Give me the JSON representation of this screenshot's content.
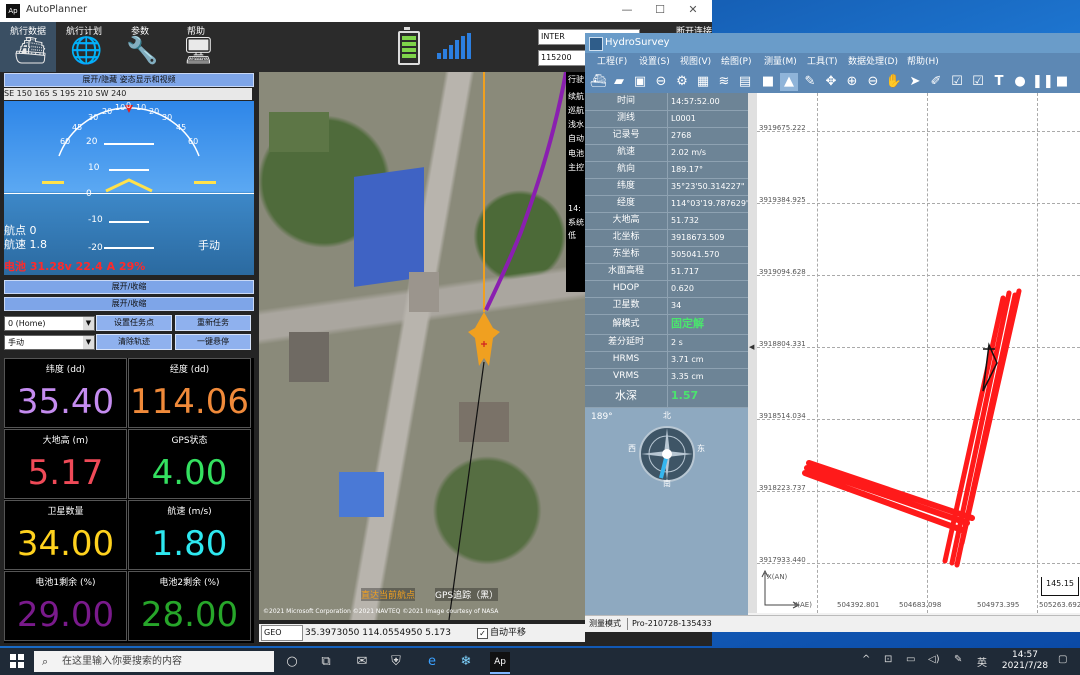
{
  "autoplanner": {
    "title": "AutoPlanner",
    "window_controls": [
      "—",
      "☐",
      "✕"
    ],
    "menu": [
      {
        "label": "航行数据",
        "icon": "boat-icon"
      },
      {
        "label": "航行计划",
        "icon": "globe-icon"
      },
      {
        "label": "参数",
        "icon": "tools-icon"
      },
      {
        "label": "帮助",
        "icon": "help-monitor-icon"
      }
    ],
    "connection": {
      "port": "INTER",
      "baud": "115200",
      "disconnect_label": "断开连接"
    },
    "panels": {
      "top_toggle": "展开/隐藏 姿态显示和视频",
      "compass_strip": "SE   150   165   S   195   210   SW   240",
      "toggle2": "展开/收缩",
      "toggle3": "展开/收缩"
    },
    "hud": {
      "arc_numbers": [
        "60",
        "45",
        "30",
        "20",
        "10",
        "0",
        "10",
        "20",
        "30",
        "45",
        "60"
      ],
      "pitch_labels": [
        "20",
        "10",
        "0",
        "-10",
        "-20"
      ],
      "waypoint": "航点 0",
      "speed": "航速 1.8",
      "mode": "手动",
      "battery": "电池 31.28v 22.4 A 29%"
    },
    "controls": {
      "waypoint_select": "0 (Home)",
      "mode_select": "手动",
      "buttons": [
        "设置任务点",
        "重新任务",
        "清除轨迹",
        "一键悬停"
      ]
    },
    "telemetry": [
      {
        "label": "纬度 (dd)",
        "value": "35.40",
        "color": "#c58cf0"
      },
      {
        "label": "经度 (dd)",
        "value": "114.06",
        "color": "#f08a3a"
      },
      {
        "label": "大地高 (m)",
        "value": "5.17",
        "color": "#f04a58"
      },
      {
        "label": "GPS状态",
        "value": "4.00",
        "color": "#34e060"
      },
      {
        "label": "卫星数量",
        "value": "34.00",
        "color": "#ffd21e"
      },
      {
        "label": "航速 (m/s)",
        "value": "1.80",
        "color": "#2ee8f0"
      },
      {
        "label": "电池1剩余 (%)",
        "value": "29.00",
        "color": "#7a1a8c"
      },
      {
        "label": "电池2剩余 (%)",
        "value": "28.00",
        "color": "#27a62a"
      }
    ],
    "right_strip": [
      "行驶",
      "续航",
      "巡航",
      "浅水",
      "自动",
      "电池",
      "主控",
      "14:",
      "系统",
      "低"
    ],
    "map": {
      "return_label": "直达当前航点",
      "gps_label": "GPS追踪（黑）",
      "copyright": "©2021 Microsoft Corporation ©2021 NAVTEQ ©2021 Image courtesy of NASA",
      "status": {
        "coord_system": "GEO",
        "readout": "35.3973050 114.0554950 5.173",
        "auto_pan": "自动平移"
      }
    }
  },
  "hydrosurvey": {
    "title": "HydroSurvey",
    "menu": [
      "工程(F)",
      "设置(S)",
      "视图(V)",
      "绘图(P)",
      "测量(M)",
      "工具(T)",
      "数据处理(D)",
      "帮助(H)"
    ],
    "toolbar_icons": [
      "ship-icon",
      "folder-icon",
      "save-icon",
      "link-icon",
      "gear-icon",
      "image-icon",
      "wave-icon",
      "note-icon",
      "video-icon",
      "survey-icon",
      "edit-icon",
      "fit-icon",
      "zoom-in-icon",
      "zoom-out-icon",
      "hand-icon",
      "pointer-icon",
      "pen-icon",
      "form-icon",
      "form2-icon",
      "text-icon",
      "record-icon",
      "pause-icon",
      "stop-icon"
    ],
    "info": [
      {
        "key": "时间",
        "value": "14:57:52.00"
      },
      {
        "key": "测线",
        "value": "L0001"
      },
      {
        "key": "记录号",
        "value": "2768"
      },
      {
        "key": "航速",
        "value": "2.02 m/s"
      },
      {
        "key": "航向",
        "value": "189.17°"
      },
      {
        "key": "纬度",
        "value": "35°23'50.314227\""
      },
      {
        "key": "经度",
        "value": "114°03'19.787629\""
      },
      {
        "key": "大地高",
        "value": "51.732"
      },
      {
        "key": "北坐标",
        "value": "3918673.509"
      },
      {
        "key": "东坐标",
        "value": "505041.570"
      },
      {
        "key": "水面高程",
        "value": "51.717"
      },
      {
        "key": "HDOP",
        "value": "0.620"
      },
      {
        "key": "卫星数",
        "value": "34"
      },
      {
        "key": "解模式",
        "value": "固定解",
        "green": true
      },
      {
        "key": "差分延时",
        "value": "2 s"
      },
      {
        "key": "HRMS",
        "value": "3.71 cm"
      },
      {
        "key": "VRMS",
        "value": "3.35 cm"
      },
      {
        "key": "水深",
        "value": "1.57",
        "green": true
      }
    ],
    "compass": {
      "heading": "189°",
      "north": "北",
      "south": "南",
      "east": "东",
      "west": "西"
    },
    "plot": {
      "y_labels": [
        "3919675.222",
        "3919384.925",
        "3919094.628",
        "3918804.331",
        "3918514.034",
        "3918223.737",
        "3917933.440"
      ],
      "x_labels": [
        "504392.801",
        "504683.098",
        "504973.395",
        "505263.692"
      ],
      "y_axis": "X(AN)",
      "x_axis": "Y(AE)",
      "scale": "145.15"
    },
    "status": {
      "mode": "测量模式",
      "project": "Pro-210728-135433"
    }
  },
  "taskbar": {
    "search_placeholder": "在这里输入你要搜索的内容",
    "time": "14:57",
    "date": "2021/7/28",
    "ime": "英"
  }
}
